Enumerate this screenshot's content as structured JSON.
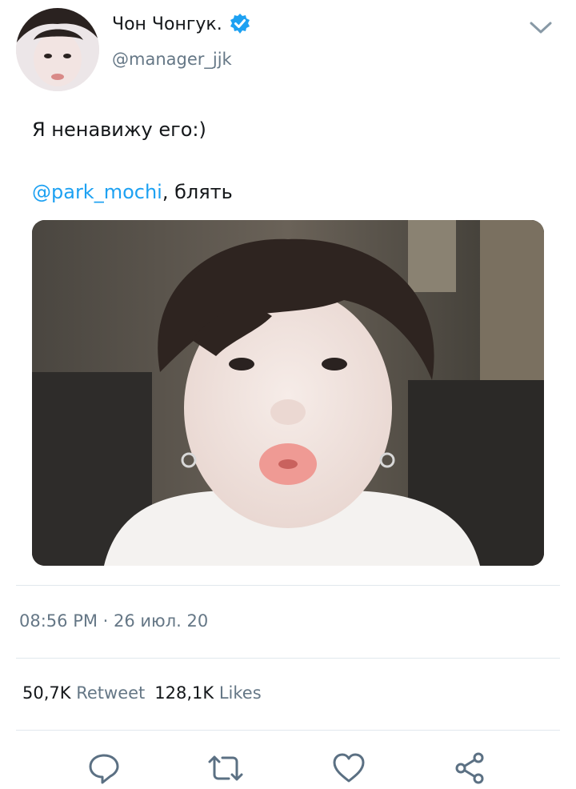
{
  "author": {
    "display_name": "Чон Чонгук.",
    "handle": "@manager_jjk",
    "verified": true,
    "avatar": "avatar-photo"
  },
  "tweet": {
    "text_line1": "Я ненавижу его:)",
    "mention": "@park_mochi",
    "text_line2_rest": ", блять",
    "media": "selfie-photo"
  },
  "meta": {
    "timestamp": "08:56 PM · 26 июл. 20"
  },
  "stats": {
    "retweets_count": "50,7K",
    "retweets_label": "Retweet",
    "likes_count": "128,1K",
    "likes_label": "Likes"
  },
  "actions": [
    "reply-icon",
    "retweet-icon",
    "like-icon",
    "share-icon"
  ],
  "colors": {
    "accent": "#1da1f2",
    "secondary_text": "#657786",
    "divider": "#e1e8ed"
  }
}
